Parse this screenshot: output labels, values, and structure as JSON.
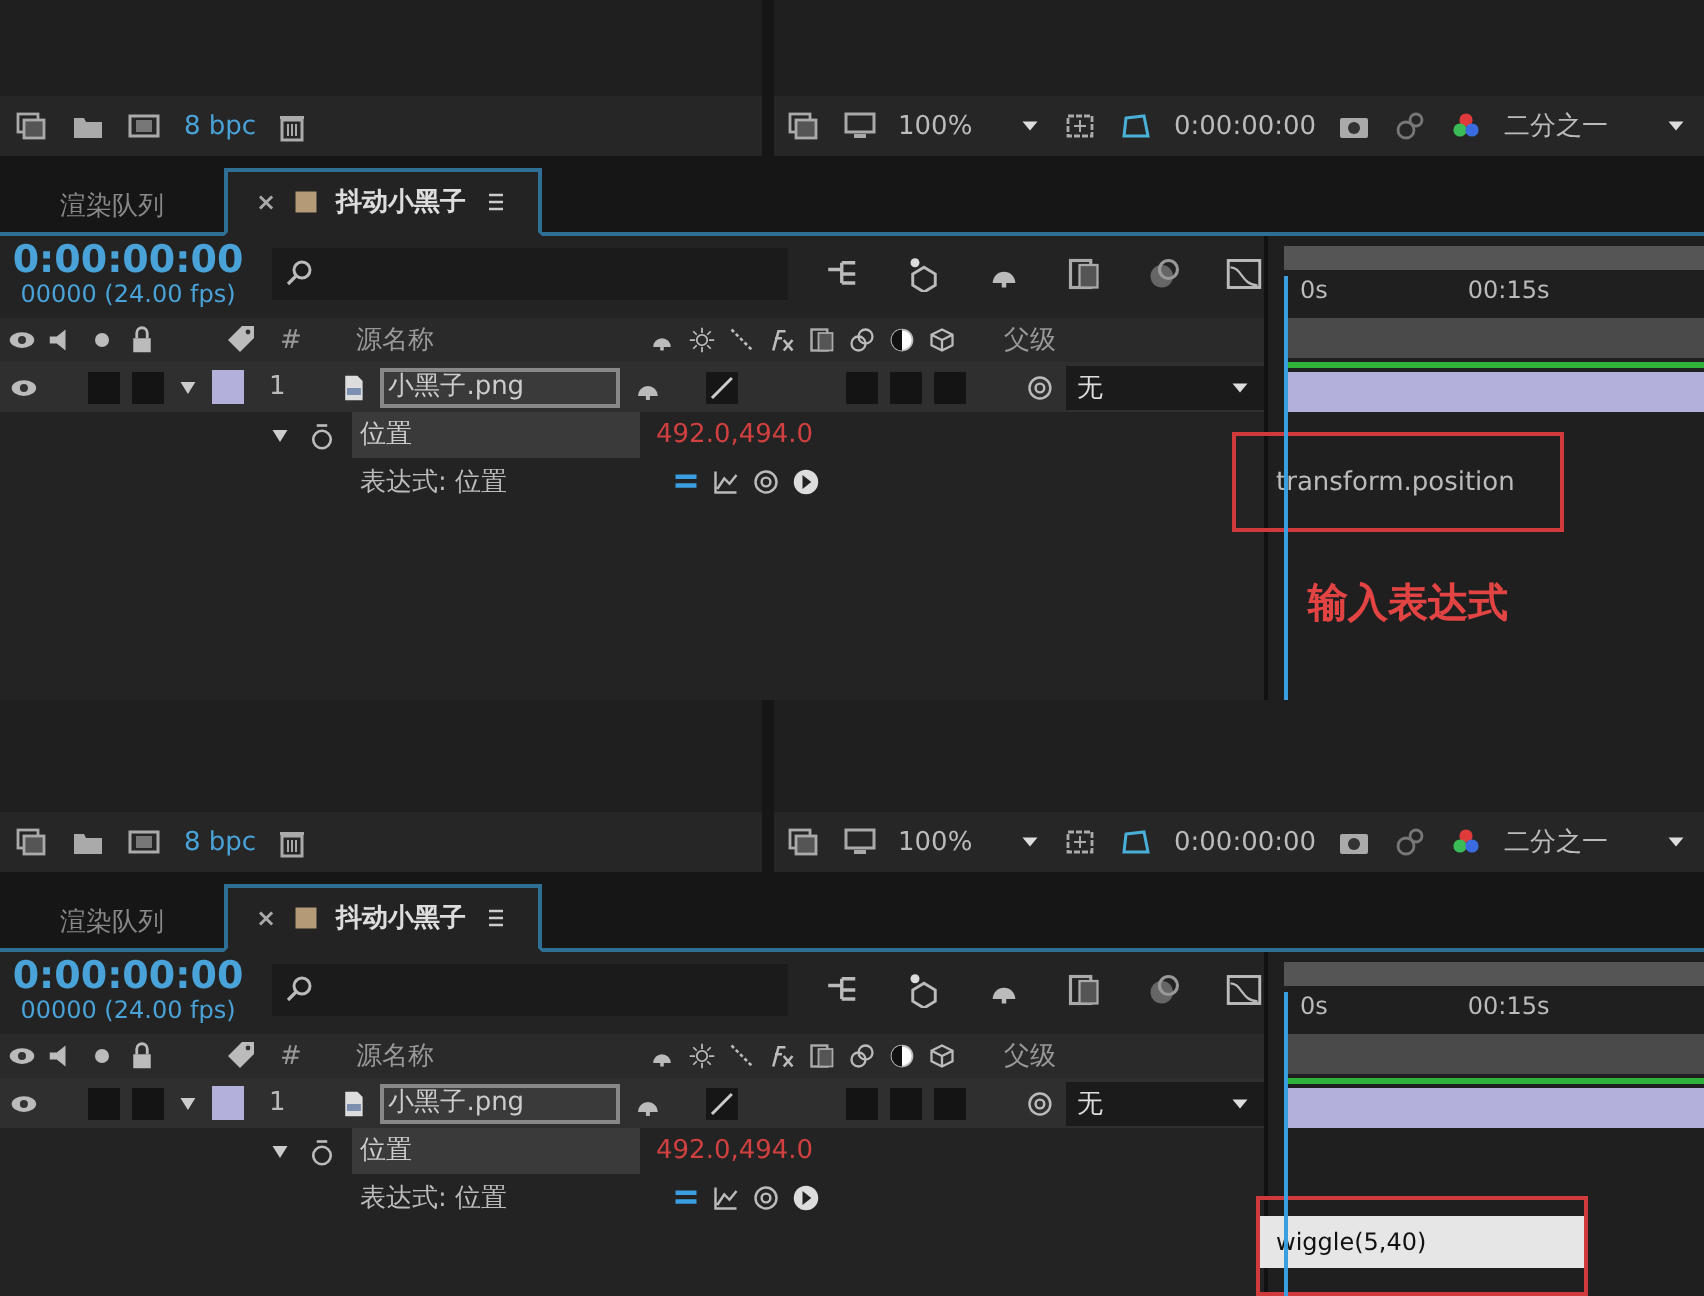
{
  "panels": [
    {
      "project_bar": {
        "bpc": "8 bpc"
      },
      "viewer_bar": {
        "zoom": "100%",
        "timecode": "0:00:00:00",
        "resolution": "二分之一"
      },
      "tabs": [
        {
          "label": "渲染队列",
          "selected": false
        },
        {
          "label": "抖动小黑子",
          "selected": true,
          "close": "×"
        }
      ],
      "timecode": "0:00:00:00",
      "fps": "00000 (24.00 fps)",
      "columns": [
        "#",
        "源名称",
        "父级"
      ],
      "ruler": [
        "0s",
        "00:15s"
      ],
      "layer": {
        "number": "1",
        "name": "小黑子.png",
        "parent": "无",
        "color": "#b3b1dc"
      },
      "property": {
        "name": "位置",
        "value": "492.0,494.0"
      },
      "expression": {
        "label": "表达式: 位置",
        "text": "transform.position",
        "editing": false
      },
      "annotation": "输入表达式"
    },
    {
      "project_bar": {
        "bpc": "8 bpc"
      },
      "viewer_bar": {
        "zoom": "100%",
        "timecode": "0:00:00:00",
        "resolution": "二分之一"
      },
      "tabs": [
        {
          "label": "渲染队列",
          "selected": false
        },
        {
          "label": "抖动小黑子",
          "selected": true,
          "close": "×"
        }
      ],
      "timecode": "0:00:00:00",
      "fps": "00000 (24.00 fps)",
      "columns": [
        "#",
        "源名称",
        "父级"
      ],
      "ruler": [
        "0s",
        "00:15s"
      ],
      "layer": {
        "number": "1",
        "name": "小黑子.png",
        "parent": "无",
        "color": "#b3b1dc"
      },
      "property": {
        "name": "位置",
        "value": "492.0,494.0"
      },
      "expression": {
        "label": "表达式: 位置",
        "text": "wiggle(5,40)",
        "editing": true
      }
    }
  ]
}
